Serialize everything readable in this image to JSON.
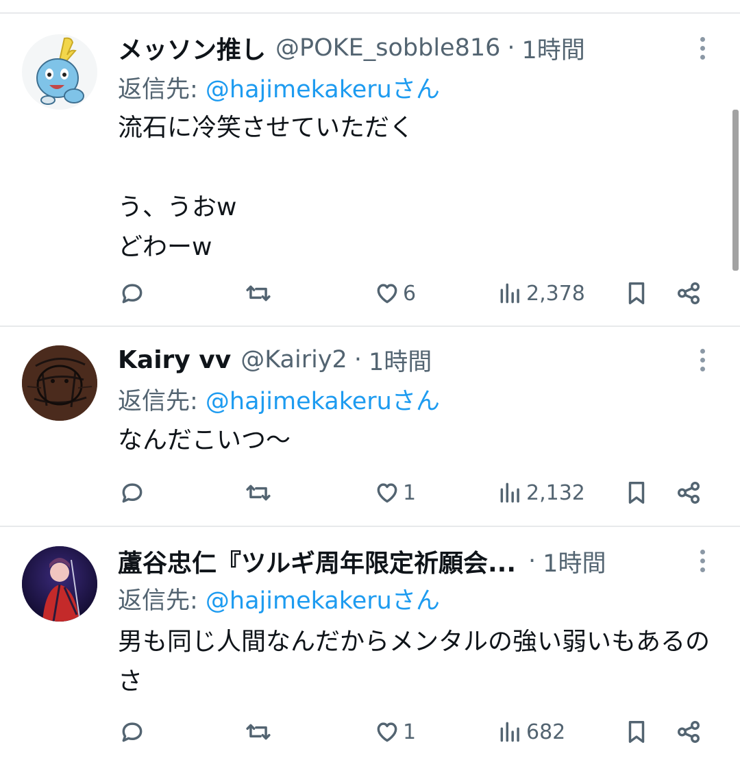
{
  "tweets": [
    {
      "name": "メッソン推し",
      "handle": "@POKE_sobble816",
      "dot": "·",
      "time": "1時間",
      "reply_prefix": "返信先: ",
      "reply_to": "@hajimekakeruさん",
      "text": "流石に冷笑させていただく\n\nう、うおw\nどわーw",
      "likes": "6",
      "views": "2,378"
    },
    {
      "name": "Kairy vv",
      "handle": "@Kairiy2",
      "dot": "·",
      "time": "1時間",
      "reply_prefix": "返信先: ",
      "reply_to": "@hajimekakeruさん",
      "text": "なんだこいつ〜",
      "likes": "1",
      "views": "2,132"
    },
    {
      "name": "蘆谷忠仁『ツルギ周年限定祈願会...",
      "handle": "",
      "dot": "·",
      "time": "1時間",
      "reply_prefix": "返信先: ",
      "reply_to": "@hajimekakeruさん",
      "text": "男も同じ人間なんだからメンタルの強い弱いもあるのさ",
      "likes": "1",
      "views": "682"
    }
  ],
  "icons": {
    "reply": "reply-icon",
    "retweet": "retweet-icon",
    "like": "heart-icon",
    "views": "bar-chart-icon",
    "bookmark": "bookmark-icon",
    "share": "share-icon",
    "more": "more-vertical-icon"
  },
  "colors": {
    "link": "#1d9bf0",
    "muted": "#536471",
    "text": "#0f1419",
    "divider": "#e7e9eb"
  }
}
